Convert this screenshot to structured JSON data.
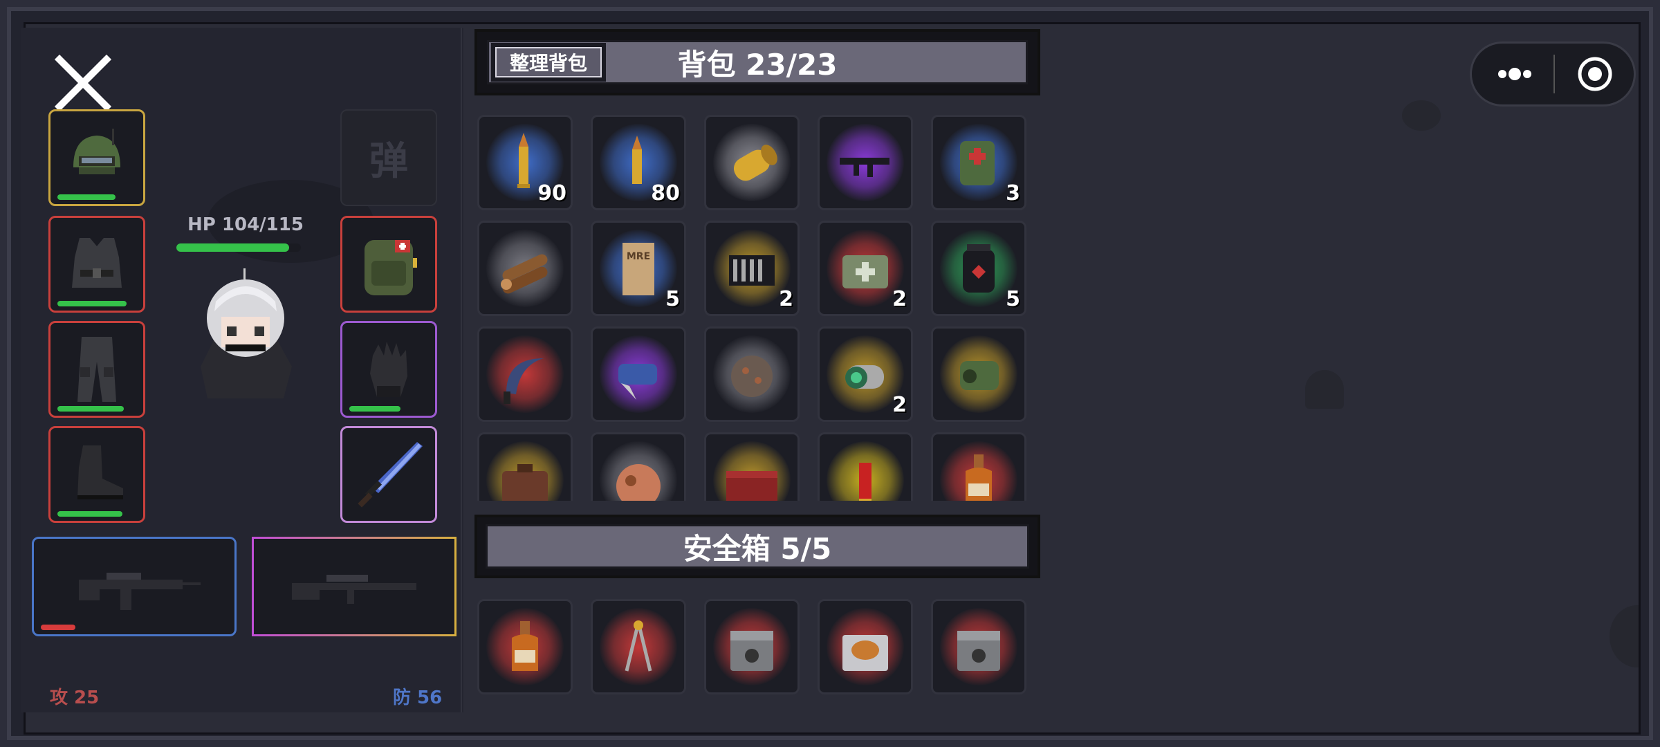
{
  "close_label": "✕",
  "ammo_slot_label": "弹",
  "hp_text": "HP 104/115",
  "hp_fraction": 0.904,
  "attack_text": "攻 25",
  "defense_text": "防 56",
  "equipment_left": [
    {
      "name": "helmet",
      "rarity": "gold",
      "durability": 0.7
    },
    {
      "name": "body-armor",
      "rarity": "red",
      "durability": 0.8
    },
    {
      "name": "pants",
      "rarity": "red",
      "durability": 0.78
    },
    {
      "name": "boots",
      "rarity": "red",
      "durability": 0.75
    }
  ],
  "equipment_right": [
    {
      "name": "backpack",
      "rarity": "red",
      "durability": 0
    },
    {
      "name": "gloves",
      "rarity": "purple",
      "durability": 0.55
    },
    {
      "name": "sword",
      "rarity": "purple",
      "durability": 0
    }
  ],
  "weapons": [
    {
      "name": "assault-rifle",
      "rarity": "blue",
      "durability": 0.18
    },
    {
      "name": "sniper-rifle",
      "rarity": "purple-gold",
      "durability": 0
    }
  ],
  "backpack": {
    "organize_label": "整理背包",
    "title": "背包  23/23",
    "items": [
      {
        "name": "rifle-bullet",
        "glow": "#3f6cc8",
        "count": "90"
      },
      {
        "name": "bullet",
        "glow": "#3f6cc8",
        "count": "80"
      },
      {
        "name": "shell-casing",
        "glow": "#8a8a92",
        "count": ""
      },
      {
        "name": "smg",
        "glow": "#8a3ad8",
        "count": ""
      },
      {
        "name": "medkit-pouch",
        "glow": "#3f6cc8",
        "count": "3"
      },
      {
        "name": "wood-logs",
        "glow": "#7a7a82",
        "count": ""
      },
      {
        "name": "mre-ration",
        "glow": "#3f6cc8",
        "count": "5"
      },
      {
        "name": "tool-set",
        "glow": "#b8942a",
        "count": "2"
      },
      {
        "name": "first-aid-box",
        "glow": "#c23838",
        "count": "2"
      },
      {
        "name": "fuel-canister",
        "glow": "#2e9a56",
        "count": "5"
      },
      {
        "name": "sickle",
        "glow": "#c23838",
        "count": ""
      },
      {
        "name": "pliers",
        "glow": "#8a3ad8",
        "count": ""
      },
      {
        "name": "ore-chunk",
        "glow": "#7a7a82",
        "count": ""
      },
      {
        "name": "lens",
        "glow": "#b8942a",
        "count": "2"
      },
      {
        "name": "rangefinder",
        "glow": "#b8942a",
        "count": ""
      },
      {
        "name": "briefcase",
        "glow": "#b8942a",
        "count": ""
      },
      {
        "name": "copper-ore",
        "glow": "#7a7a82",
        "count": ""
      },
      {
        "name": "red-box",
        "glow": "#b8942a",
        "count": ""
      },
      {
        "name": "shotgun-shell",
        "glow": "#c8b020",
        "count": ""
      },
      {
        "name": "liquor-bottle",
        "glow": "#c23838",
        "count": ""
      }
    ]
  },
  "safebox": {
    "title": "安全箱  5/5",
    "items": [
      {
        "name": "liquor-bottle",
        "glow": "#c23838"
      },
      {
        "name": "compass-divider",
        "glow": "#c23838"
      },
      {
        "name": "radioactive-case",
        "glow": "#c23838"
      },
      {
        "name": "roast-chicken-case",
        "glow": "#c23838"
      },
      {
        "name": "radioactive-case",
        "glow": "#c23838"
      }
    ]
  },
  "miniapp": {
    "more_icon": "more-icon",
    "close_icon": "target-icon"
  }
}
